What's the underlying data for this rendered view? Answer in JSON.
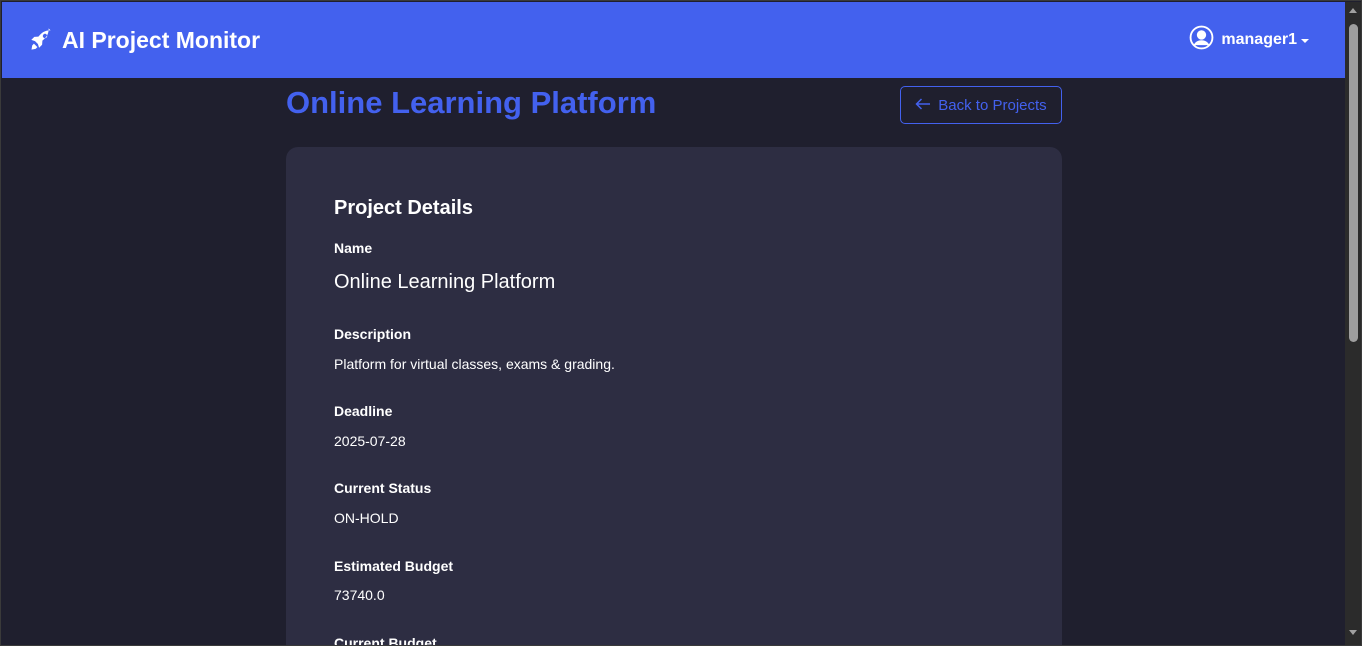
{
  "app": {
    "brand": "AI Project Monitor",
    "brand_icon": "rocket-icon",
    "user": "manager1",
    "user_icon": "user-circle-icon"
  },
  "page": {
    "title": "Online Learning Platform",
    "back_button": "Back to Projects",
    "back_icon": "arrow-left-icon"
  },
  "details": {
    "heading": "Project Details",
    "fields": [
      {
        "label": "Name",
        "value": "Online Learning Platform"
      },
      {
        "label": "Description",
        "value": "Platform for virtual classes, exams & grading."
      },
      {
        "label": "Deadline",
        "value": "2025-07-28"
      },
      {
        "label": "Current Status",
        "value": "ON-HOLD"
      },
      {
        "label": "Estimated Budget",
        "value": "73740.0"
      },
      {
        "label": "Current Budget",
        "value": ""
      }
    ]
  },
  "colors": {
    "accent": "#4361ee",
    "background": "#1f1f2e",
    "card": "#2d2d42",
    "text": "#ffffff"
  }
}
